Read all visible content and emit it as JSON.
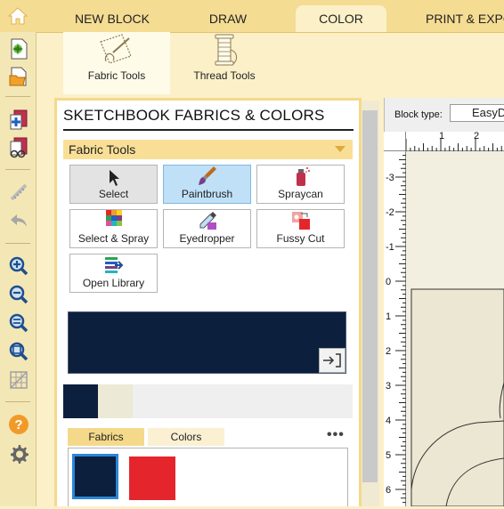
{
  "tabs": [
    {
      "label": "NEW BLOCK"
    },
    {
      "label": "DRAW"
    },
    {
      "label": "COLOR"
    },
    {
      "label": "PRINT & EXPO"
    }
  ],
  "ribbon": {
    "fabric_tools": "Fabric Tools",
    "thread_tools": "Thread Tools"
  },
  "panel": {
    "title": "SKETCHBOOK FABRICS & COLORS",
    "group": "Fabric Tools",
    "tools": {
      "select": "Select",
      "paintbrush": "Paintbrush",
      "spraycan": "Spraycan",
      "select_spray": "Select & Spray",
      "eyedropper": "Eyedropper",
      "fussy_cut": "Fussy Cut",
      "open_library": "Open Library"
    },
    "subtabs": {
      "fabrics": "Fabrics",
      "colors": "Colors"
    },
    "more": "•••"
  },
  "colors": {
    "current_fabric": "#0c1f3c",
    "recent_1": "#0c1f3c",
    "recent_2": "#ece9d6",
    "grid_1": "#0c1f3c",
    "grid_2": "#e5252c",
    "accent": "#f5d98b"
  },
  "block": {
    "label": "Block type:",
    "value": "EasyD"
  },
  "ruler": {
    "top": [
      "1",
      "2"
    ],
    "left": [
      "-3",
      "-2",
      "-1",
      "0",
      "1",
      "2",
      "3",
      "4",
      "5",
      "6"
    ]
  }
}
